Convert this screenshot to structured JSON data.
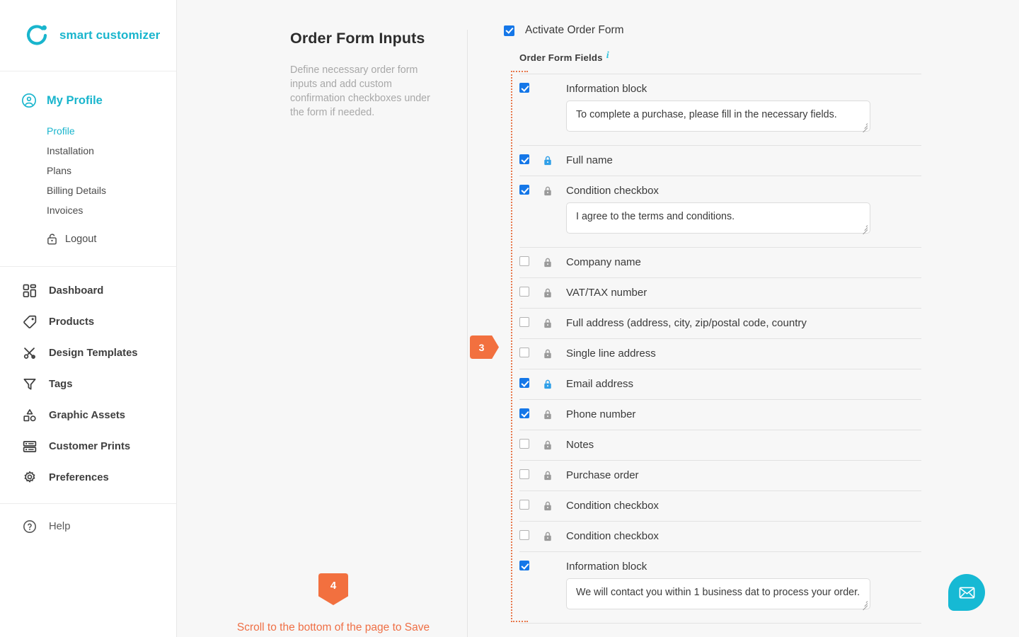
{
  "brand": {
    "name": "smart customizer",
    "logo_icon": "circle-dot-logo-icon"
  },
  "sidebar": {
    "profile_section": {
      "label": "My Profile",
      "icon": "user-circle-icon",
      "items": [
        {
          "label": "Profile",
          "active": true
        },
        {
          "label": "Installation",
          "active": false
        },
        {
          "label": "Plans",
          "active": false
        },
        {
          "label": "Billing Details",
          "active": false
        },
        {
          "label": "Invoices",
          "active": false
        }
      ],
      "logout": {
        "label": "Logout",
        "icon": "unlock-icon"
      }
    },
    "main_items": [
      {
        "label": "Dashboard",
        "icon": "dashboard-grid-icon"
      },
      {
        "label": "Products",
        "icon": "tag-icon"
      },
      {
        "label": "Design Templates",
        "icon": "scissors-icon"
      },
      {
        "label": "Tags",
        "icon": "funnel-icon"
      },
      {
        "label": "Graphic Assets",
        "icon": "shapes-icon"
      },
      {
        "label": "Customer Prints",
        "icon": "layers-icon"
      },
      {
        "label": "Preferences",
        "icon": "gear-icon"
      }
    ],
    "help": {
      "label": "Help",
      "icon": "question-circle-icon"
    }
  },
  "description": {
    "title": "Order Form Inputs",
    "body": "Define necessary order form inputs and add custom confirmation checkboxes under the form if needed."
  },
  "save_hint": {
    "badge": "4",
    "text": "Scroll to the bottom of the page to Save"
  },
  "form": {
    "activate": {
      "label": "Activate Order Form",
      "checked": true
    },
    "fields_header": {
      "label": "Order Form Fields",
      "info_icon": "info-icon"
    },
    "step_badge": "3",
    "rows": [
      {
        "label": "Information block",
        "checked": true,
        "lock": "none",
        "text": "To complete a purchase, please fill in the necessary fields."
      },
      {
        "label": "Full name",
        "checked": true,
        "lock": "blue",
        "text": null
      },
      {
        "label": "Condition checkbox",
        "checked": true,
        "lock": "gray",
        "text": "I agree to the terms and conditions."
      },
      {
        "label": "Company name",
        "checked": false,
        "lock": "gray",
        "text": null
      },
      {
        "label": "VAT/TAX number",
        "checked": false,
        "lock": "gray",
        "text": null
      },
      {
        "label": "Full address (address, city, zip/postal code, country",
        "checked": false,
        "lock": "gray",
        "text": null
      },
      {
        "label": "Single line address",
        "checked": false,
        "lock": "gray",
        "text": null
      },
      {
        "label": "Email address",
        "checked": true,
        "lock": "blue",
        "text": null
      },
      {
        "label": "Phone number",
        "checked": true,
        "lock": "gray",
        "text": null
      },
      {
        "label": "Notes",
        "checked": false,
        "lock": "gray",
        "text": null
      },
      {
        "label": "Purchase order",
        "checked": false,
        "lock": "gray",
        "text": null
      },
      {
        "label": "Condition checkbox",
        "checked": false,
        "lock": "gray",
        "text": null
      },
      {
        "label": "Condition checkbox",
        "checked": false,
        "lock": "gray",
        "text": null
      },
      {
        "label": "Information block",
        "checked": true,
        "lock": "none",
        "text": "We will contact you within 1 business dat to process your order."
      }
    ]
  },
  "chat_widget": {
    "icon": "envelope-icon"
  },
  "colors": {
    "brand_cyan": "#19b5cd",
    "accent_orange": "#f2703f",
    "checkbox_blue": "#1577e8",
    "lock_blue": "#2f9fe8",
    "page_bg": "#f7f7f7"
  }
}
